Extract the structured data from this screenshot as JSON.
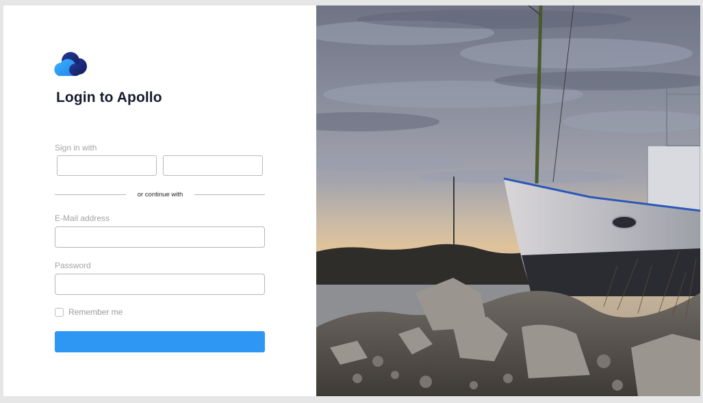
{
  "login": {
    "title": "Login to Apollo",
    "sign_in_with_label": "Sign in with",
    "providers": [
      {
        "label": ""
      },
      {
        "label": ""
      }
    ],
    "divider_text": "or continue with",
    "email": {
      "label": "E-Mail address",
      "value": "",
      "placeholder": ""
    },
    "password": {
      "label": "Password",
      "value": "",
      "placeholder": ""
    },
    "remember_me": {
      "label": "Remember me",
      "checked": false
    },
    "submit_label": ""
  },
  "colors": {
    "brand_light_blue": "#2d97f3",
    "brand_dark_blue": "#1c2a78",
    "title_text": "#161a2e",
    "muted_text": "#a3a3a3"
  },
  "icons": {
    "logo": "cloud-logo-icon"
  },
  "hero_image": {
    "subject": "rusted boat on rocky shore at dusk"
  }
}
